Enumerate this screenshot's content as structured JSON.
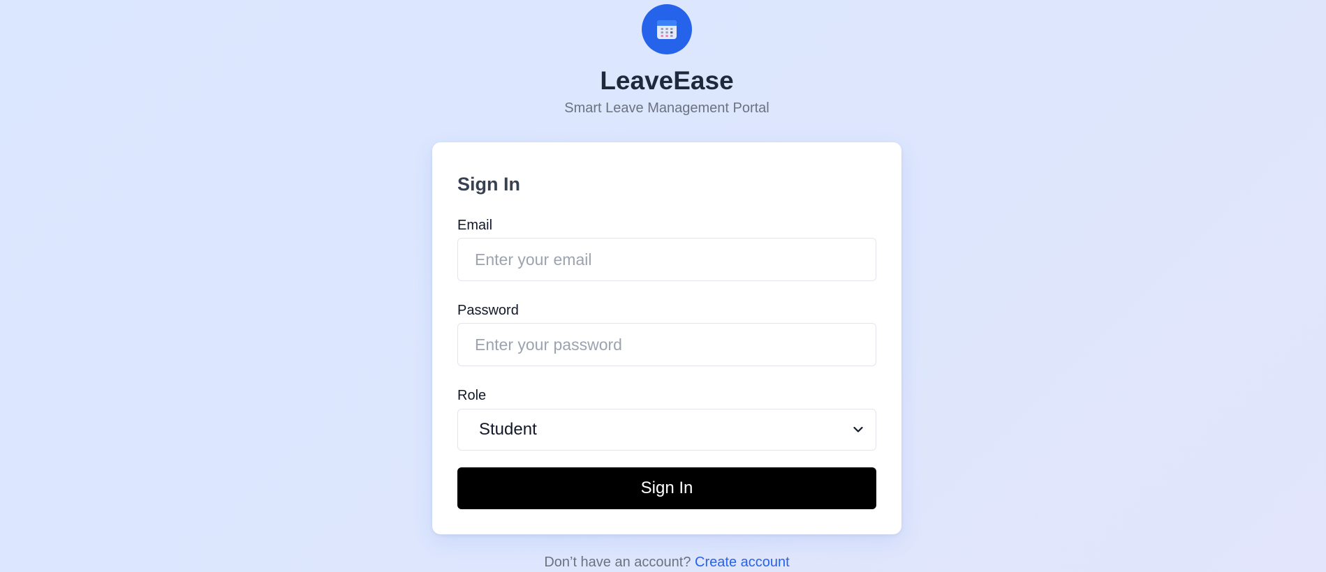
{
  "brand": {
    "logo_icon": "calendar-icon",
    "title": "LeaveEase",
    "subtitle": "Smart Leave Management Portal"
  },
  "form": {
    "title": "Sign In",
    "email": {
      "label": "Email",
      "value": "",
      "placeholder": "Enter your email"
    },
    "password": {
      "label": "Password",
      "value": "",
      "placeholder": "Enter your password"
    },
    "role": {
      "label": "Role",
      "selected": "Student",
      "icon": "chevron-down-icon"
    },
    "submit_label": "Sign In"
  },
  "footer": {
    "prompt": "Don’t have an account?",
    "link_label": "Create account"
  },
  "colors": {
    "accent": "#2563eb",
    "button": "#000000",
    "background": "#dbe7fe"
  }
}
